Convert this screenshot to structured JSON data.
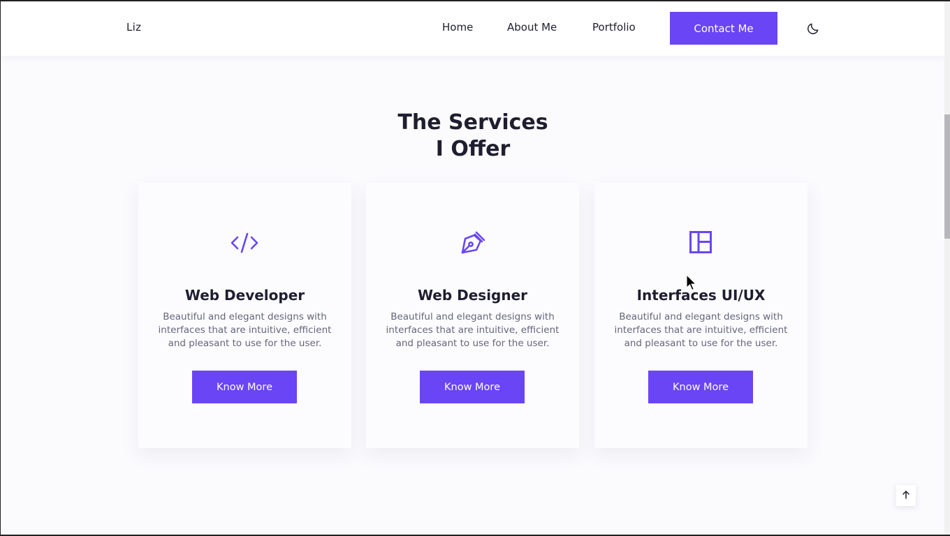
{
  "header": {
    "logo": "Liz",
    "nav": {
      "home": "Home",
      "about": "About Me",
      "portfolio": "Portfolio",
      "contact": "Contact Me"
    },
    "theme_icon": "moon-icon"
  },
  "services": {
    "title_line1": "The Services",
    "title_line2": "I Offer",
    "cards": [
      {
        "icon": "code-icon",
        "title": "Web Developer",
        "description": "Beautiful and elegant designs with interfaces that are intuitive, efficient and pleasant to use for the user.",
        "button": "Know More"
      },
      {
        "icon": "pen-tool-icon",
        "title": "Web Designer",
        "description": "Beautiful and elegant designs with interfaces that are intuitive, efficient and pleasant to use for the user.",
        "button": "Know More"
      },
      {
        "icon": "layout-icon",
        "title": "Interfaces UI/UX",
        "description": "Beautiful and elegant designs with interfaces that are intuitive, efficient and pleasant to use for the user.",
        "button": "Know More"
      }
    ]
  },
  "scroll_top_icon": "arrow-up-icon",
  "colors": {
    "accent": "#6a45f5",
    "text": "#1e1e2f",
    "muted": "#65657a",
    "background": "#fbfbfe"
  }
}
